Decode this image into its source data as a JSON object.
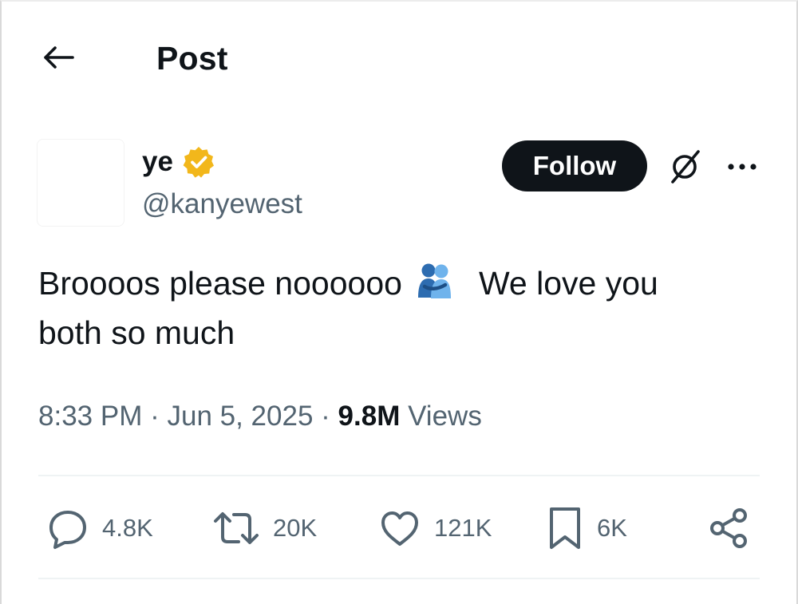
{
  "header": {
    "title": "Post",
    "back_icon": "arrow-left-icon"
  },
  "author": {
    "display_name": "ye",
    "handle": "@kanyewest",
    "verified_color": "#f2b71b"
  },
  "actions_top": {
    "follow_label": "Follow",
    "grok_icon": "grok-icon",
    "more_icon": "more-icon"
  },
  "tweet": {
    "line1_part1": "Broooos please noooooo",
    "emoji": "people-hugging",
    "line1_part2": "We love you",
    "line2": "both so much"
  },
  "meta": {
    "time": "8:33 PM",
    "separator": "·",
    "date": "Jun 5, 2025",
    "views_count": "9.8M",
    "views_label": "Views"
  },
  "engagement": {
    "replies": "4.8K",
    "reposts": "20K",
    "likes": "121K",
    "bookmarks": "6K"
  },
  "colors": {
    "text_primary": "#0f1419",
    "text_secondary": "#536471",
    "follow_bg": "#0f1419"
  }
}
